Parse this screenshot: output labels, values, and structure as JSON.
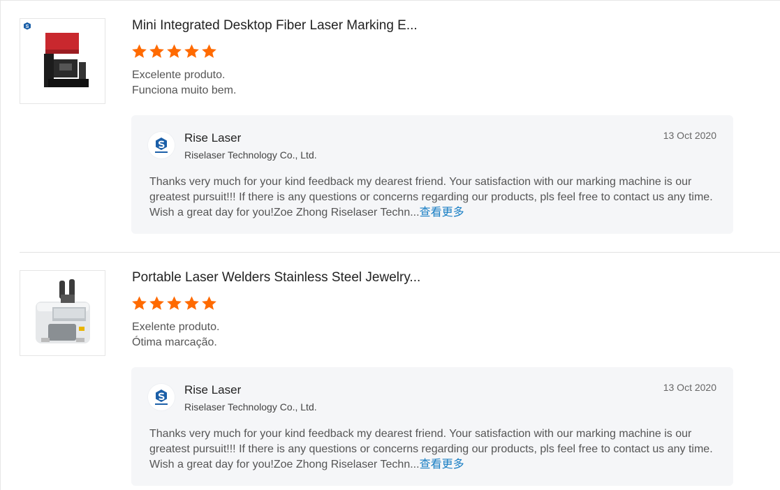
{
  "reviews": [
    {
      "product_title": "Mini Integrated Desktop Fiber Laser Marking E...",
      "rating": 5,
      "rating_max": 5,
      "review_lines": [
        "Excelente produto.",
        "Funciona muito bem."
      ],
      "reply": {
        "seller_name": "Rise Laser",
        "company": "Riselaser Technology Co., Ltd.",
        "date": "13 Oct 2020",
        "body": "Thanks very much for your kind feedback my dearest friend. Your satisfaction with our marking machine  is our greatest pursuit!!! If there is any questions or concerns regarding our products, pls feel free to contact us any time. Wish a great day for you!Zoe Zhong Riselaser Techn...",
        "more_label": "查看更多"
      }
    },
    {
      "product_title": "Portable Laser Welders Stainless Steel Jewelry...",
      "rating": 5,
      "rating_max": 5,
      "review_lines": [
        "Exelente produto.",
        "Ótima marcação."
      ],
      "reply": {
        "seller_name": "Rise Laser",
        "company": "Riselaser Technology Co., Ltd.",
        "date": "13 Oct 2020",
        "body": "Thanks very much for your kind feedback my dearest friend. Your satisfaction with our marking machine  is our greatest pursuit!!! If there is any questions or concerns regarding our products, pls feel free to contact us any time. Wish a great day for you!Zoe Zhong Riselaser Techn...",
        "more_label": "查看更多"
      }
    }
  ],
  "icons": {
    "star": "star-icon",
    "seller_logo": "riselaser-logo",
    "product1": "laser-marking-machine-image",
    "product2": "laser-welder-image"
  },
  "colors": {
    "star": "#ff6a00",
    "link": "#1a7fc4",
    "reply_bg": "#f5f6f8",
    "logo_blue": "#1b5fa8"
  }
}
